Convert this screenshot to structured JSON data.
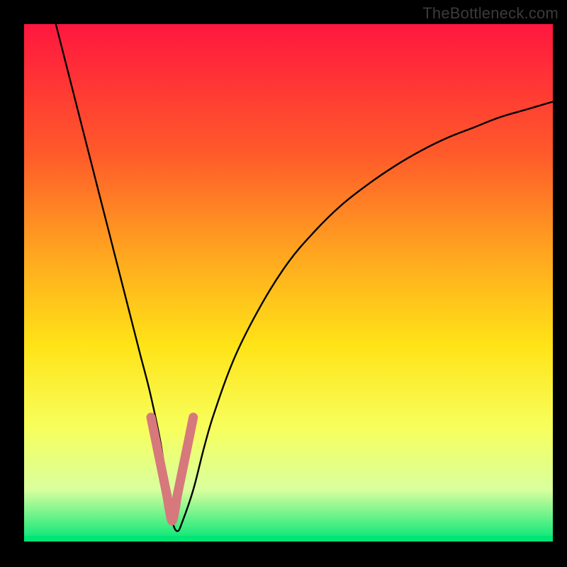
{
  "watermark": "TheBottleneck.com",
  "colors": {
    "page_bg": "#000000",
    "gradient_top": "#ff173f",
    "gradient_mid1": "#ff5a2a",
    "gradient_mid2": "#ffa81f",
    "gradient_mid3": "#ffe317",
    "gradient_mid4": "#f7ff5c",
    "gradient_low": "#d9ff9e",
    "gradient_green": "#00e676",
    "curve": "#000000",
    "tip_highlight": "#d6787c"
  },
  "chart_data": {
    "type": "line",
    "title": "",
    "xlabel": "",
    "ylabel": "",
    "xlim": [
      0,
      100
    ],
    "ylim": [
      0,
      100
    ],
    "series": [
      {
        "name": "bottleneck-curve",
        "x": [
          6,
          8,
          10,
          12,
          14,
          16,
          18,
          20,
          22,
          24,
          26,
          27,
          28,
          29,
          30,
          32,
          34,
          36,
          40,
          45,
          50,
          55,
          60,
          65,
          70,
          75,
          80,
          85,
          90,
          95,
          100
        ],
        "y": [
          100,
          92,
          84,
          76,
          68,
          60,
          52,
          44,
          36,
          28,
          18,
          10,
          4,
          2,
          4,
          10,
          18,
          25,
          36,
          46,
          54,
          60,
          65,
          69,
          72.5,
          75.5,
          78,
          80,
          82,
          83.5,
          85
        ]
      },
      {
        "name": "tip-highlight",
        "x": [
          24,
          25,
          26,
          27,
          27.5,
          28,
          28.5,
          29,
          30,
          31,
          32
        ],
        "y": [
          24,
          19,
          14,
          9,
          6,
          4,
          6,
          9,
          14,
          19,
          24
        ]
      }
    ],
    "annotations": []
  }
}
